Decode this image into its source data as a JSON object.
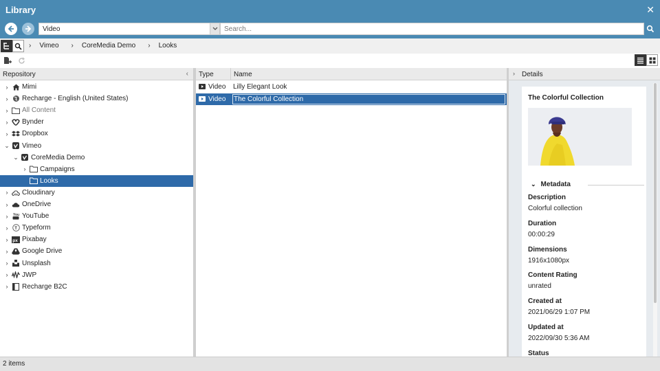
{
  "window": {
    "title": "Library",
    "close_glyph": "✕"
  },
  "nav": {
    "type_value": "Video",
    "search_placeholder": "Search..."
  },
  "breadcrumb": [
    {
      "label": "Vimeo"
    },
    {
      "label": "CoreMedia Demo"
    },
    {
      "label": "Looks"
    }
  ],
  "repository": {
    "header": "Repository",
    "tree": [
      {
        "label": "Mimi",
        "icon": "home-icon",
        "depth": 0,
        "expander": "›"
      },
      {
        "label": "Recharge - English (United States)",
        "icon": "globe-icon",
        "depth": 0,
        "expander": "›"
      },
      {
        "label": "All Content",
        "icon": "folder-icon",
        "depth": 0,
        "expander": "›",
        "muted": true
      },
      {
        "label": "Bynder",
        "icon": "bynder-icon",
        "depth": 0,
        "expander": "›"
      },
      {
        "label": "Dropbox",
        "icon": "dropbox-icon",
        "depth": 0,
        "expander": "›"
      },
      {
        "label": "Vimeo",
        "icon": "vimeo-icon",
        "depth": 0,
        "expander": "⌄"
      },
      {
        "label": "CoreMedia Demo",
        "icon": "vimeo-icon",
        "depth": 1,
        "expander": "⌄"
      },
      {
        "label": "Campaigns",
        "icon": "folder-icon",
        "depth": 2,
        "expander": "›"
      },
      {
        "label": "Looks",
        "icon": "folder-icon",
        "depth": 2,
        "expander": "",
        "selected": true
      },
      {
        "label": "Cloudinary",
        "icon": "cloudinary-icon",
        "depth": 0,
        "expander": "›"
      },
      {
        "label": "OneDrive",
        "icon": "cloud-icon",
        "depth": 0,
        "expander": "›"
      },
      {
        "label": "YouTube",
        "icon": "youtube-icon",
        "depth": 0,
        "expander": "›"
      },
      {
        "label": "Typeform",
        "icon": "typeform-icon",
        "depth": 0,
        "expander": "›"
      },
      {
        "label": "Pixabay",
        "icon": "pixabay-icon",
        "depth": 0,
        "expander": "›"
      },
      {
        "label": "Google Drive",
        "icon": "google-drive-icon",
        "depth": 0,
        "expander": "›"
      },
      {
        "label": "Unsplash",
        "icon": "unsplash-icon",
        "depth": 0,
        "expander": "›"
      },
      {
        "label": "JWP",
        "icon": "jwp-icon",
        "depth": 0,
        "expander": "›"
      },
      {
        "label": "Recharge B2C",
        "icon": "site-icon",
        "depth": 0,
        "expander": "›"
      }
    ]
  },
  "list": {
    "col_type": "Type",
    "col_name": "Name",
    "rows": [
      {
        "type": "Video",
        "name": "Lilly Elegant Look",
        "selected": false
      },
      {
        "type": "Video",
        "name": "The Colorful Collection",
        "selected": true
      }
    ]
  },
  "details": {
    "header": "Details",
    "title": "The Colorful Collection",
    "metadata_header": "Metadata",
    "fields": [
      {
        "label": "Description",
        "value": "Colorful collection"
      },
      {
        "label": "Duration",
        "value": "00:00:29"
      },
      {
        "label": "Dimensions",
        "value": "1916x1080px"
      },
      {
        "label": "Content Rating",
        "value": "unrated"
      },
      {
        "label": "Created at",
        "value": "2021/06/29 1:07 PM"
      },
      {
        "label": "Updated at",
        "value": "2022/09/30 5:36 AM"
      },
      {
        "label": "Status",
        "value": ""
      }
    ]
  },
  "status": {
    "text": "2 items"
  },
  "colors": {
    "header_blue": "#4a8ab3",
    "selection_blue": "#2e6aa9"
  }
}
